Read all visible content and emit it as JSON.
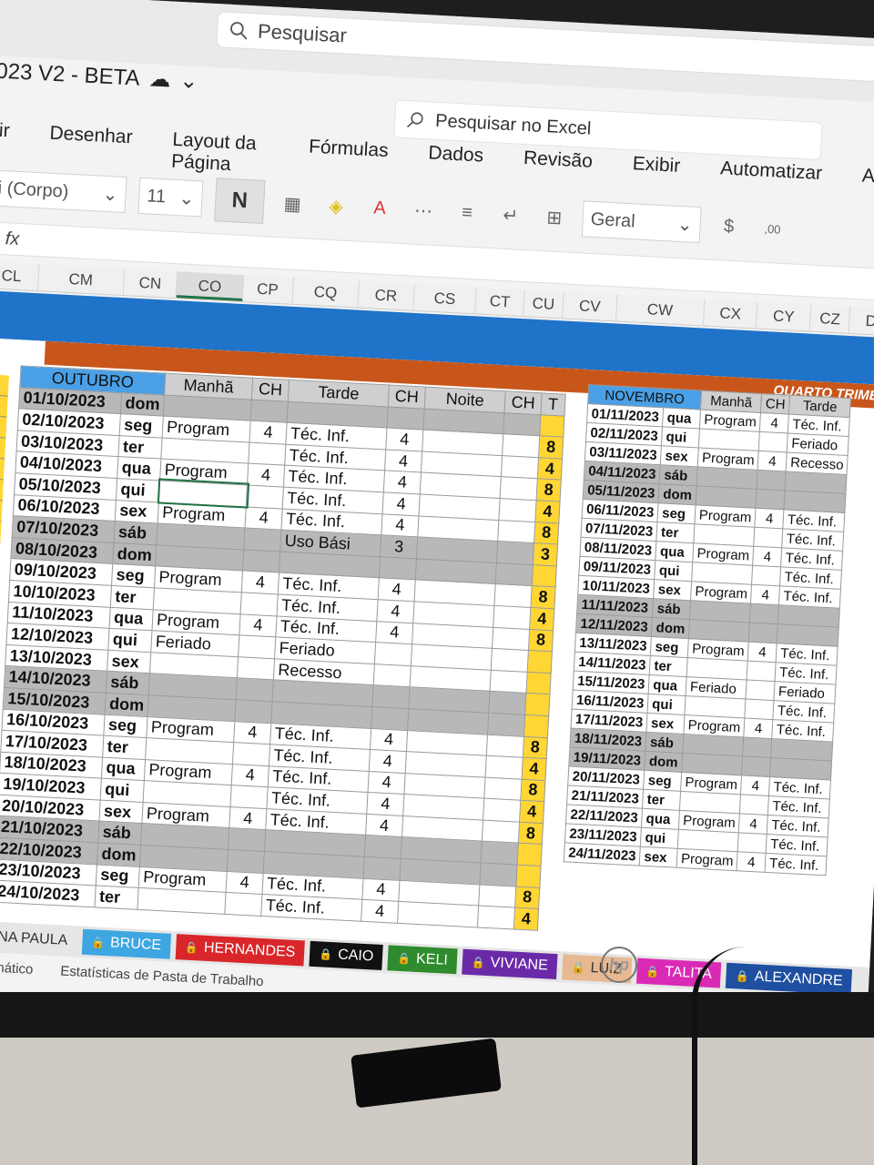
{
  "window": {
    "search_placeholder": "Pesquisar",
    "title": "023 V2 - BETA",
    "excel_search": "Pesquisar no Excel"
  },
  "menu": [
    "rir",
    "Desenhar",
    "Layout da Página",
    "Fórmulas",
    "Dados",
    "Revisão",
    "Exibir",
    "Automatizar",
    "Ajuda"
  ],
  "ribbon": {
    "font": "i (Corpo)",
    "size": "11",
    "bold": "N",
    "number_format": "Geral",
    "currency": "$",
    "decimal": ",00"
  },
  "formula_label": "fx",
  "columns": [
    "CL",
    "CM",
    "CN",
    "CO",
    "CP",
    "CQ",
    "CR",
    "CS",
    "CT",
    "CU",
    "CV",
    "CW",
    "CX",
    "CY",
    "CZ",
    "DA"
  ],
  "active_column": "CO",
  "band_title": "QUARTO TRIMESTI",
  "october": {
    "header": [
      "OUTUBRO",
      "Manhã",
      "CH",
      "Tarde",
      "CH",
      "Noite",
      "CH",
      "T"
    ],
    "rows": [
      {
        "date": "01/10/2023",
        "day": "dom",
        "m": "",
        "mch": "",
        "t": "",
        "tch": "",
        "tot": "",
        "w": true
      },
      {
        "date": "02/10/2023",
        "day": "seg",
        "m": "Program",
        "mch": "4",
        "t": "Téc. Inf.",
        "tch": "4",
        "tot": "8",
        "w": false
      },
      {
        "date": "03/10/2023",
        "day": "ter",
        "m": "",
        "mch": "",
        "t": "Téc. Inf.",
        "tch": "4",
        "tot": "4",
        "w": false
      },
      {
        "date": "04/10/2023",
        "day": "qua",
        "m": "Program",
        "mch": "4",
        "t": "Téc. Inf.",
        "tch": "4",
        "tot": "8",
        "w": false
      },
      {
        "date": "05/10/2023",
        "day": "qui",
        "m": "",
        "mch": "",
        "t": "Téc. Inf.",
        "tch": "4",
        "tot": "4",
        "w": false
      },
      {
        "date": "06/10/2023",
        "day": "sex",
        "m": "Program",
        "mch": "4",
        "t": "Téc. Inf.",
        "tch": "4",
        "tot": "8",
        "w": false
      },
      {
        "date": "07/10/2023",
        "day": "sáb",
        "m": "",
        "mch": "",
        "t": "Uso Bási",
        "tch": "3",
        "tot": "3",
        "w": true
      },
      {
        "date": "08/10/2023",
        "day": "dom",
        "m": "",
        "mch": "",
        "t": "",
        "tch": "",
        "tot": "",
        "w": true
      },
      {
        "date": "09/10/2023",
        "day": "seg",
        "m": "Program",
        "mch": "4",
        "t": "Téc. Inf.",
        "tch": "4",
        "tot": "8",
        "w": false
      },
      {
        "date": "10/10/2023",
        "day": "ter",
        "m": "",
        "mch": "",
        "t": "Téc. Inf.",
        "tch": "4",
        "tot": "4",
        "w": false
      },
      {
        "date": "11/10/2023",
        "day": "qua",
        "m": "Program",
        "mch": "4",
        "t": "Téc. Inf.",
        "tch": "4",
        "tot": "8",
        "w": false
      },
      {
        "date": "12/10/2023",
        "day": "qui",
        "m": "Feriado",
        "mch": "",
        "t": "Feriado",
        "tch": "",
        "tot": "",
        "w": false
      },
      {
        "date": "13/10/2023",
        "day": "sex",
        "m": "",
        "mch": "",
        "t": "Recesso",
        "tch": "",
        "tot": "",
        "w": false
      },
      {
        "date": "14/10/2023",
        "day": "sáb",
        "m": "",
        "mch": "",
        "t": "",
        "tch": "",
        "tot": "",
        "w": true
      },
      {
        "date": "15/10/2023",
        "day": "dom",
        "m": "",
        "mch": "",
        "t": "",
        "tch": "",
        "tot": "",
        "w": true
      },
      {
        "date": "16/10/2023",
        "day": "seg",
        "m": "Program",
        "mch": "4",
        "t": "Téc. Inf.",
        "tch": "4",
        "tot": "8",
        "w": false
      },
      {
        "date": "17/10/2023",
        "day": "ter",
        "m": "",
        "mch": "",
        "t": "Téc. Inf.",
        "tch": "4",
        "tot": "4",
        "w": false
      },
      {
        "date": "18/10/2023",
        "day": "qua",
        "m": "Program",
        "mch": "4",
        "t": "Téc. Inf.",
        "tch": "4",
        "tot": "8",
        "w": false
      },
      {
        "date": "19/10/2023",
        "day": "qui",
        "m": "",
        "mch": "",
        "t": "Téc. Inf.",
        "tch": "4",
        "tot": "4",
        "w": false
      },
      {
        "date": "20/10/2023",
        "day": "sex",
        "m": "Program",
        "mch": "4",
        "t": "Téc. Inf.",
        "tch": "4",
        "tot": "8",
        "w": false
      },
      {
        "date": "21/10/2023",
        "day": "sáb",
        "m": "",
        "mch": "",
        "t": "",
        "tch": "",
        "tot": "",
        "w": true
      },
      {
        "date": "22/10/2023",
        "day": "dom",
        "m": "",
        "mch": "",
        "t": "",
        "tch": "",
        "tot": "",
        "w": true
      },
      {
        "date": "23/10/2023",
        "day": "seg",
        "m": "Program",
        "mch": "4",
        "t": "Téc. Inf.",
        "tch": "4",
        "tot": "8",
        "w": false
      },
      {
        "date": "24/10/2023",
        "day": "ter",
        "m": "",
        "mch": "",
        "t": "Téc. Inf.",
        "tch": "4",
        "tot": "4",
        "w": false
      }
    ]
  },
  "november": {
    "header": [
      "NOVEMBRO",
      "Manhã",
      "CH",
      "Tarde"
    ],
    "rows": [
      {
        "date": "01/11/2023",
        "day": "qua",
        "m": "Program",
        "mch": "4",
        "t": "Téc. Inf.",
        "w": false
      },
      {
        "date": "02/11/2023",
        "day": "qui",
        "m": "",
        "mch": "",
        "t": "Feriado",
        "w": false
      },
      {
        "date": "03/11/2023",
        "day": "sex",
        "m": "Program",
        "mch": "4",
        "t": "Recesso",
        "w": false
      },
      {
        "date": "04/11/2023",
        "day": "sáb",
        "m": "",
        "mch": "",
        "t": "",
        "w": true
      },
      {
        "date": "05/11/2023",
        "day": "dom",
        "m": "",
        "mch": "",
        "t": "",
        "w": true
      },
      {
        "date": "06/11/2023",
        "day": "seg",
        "m": "Program",
        "mch": "4",
        "t": "Téc. Inf.",
        "w": false
      },
      {
        "date": "07/11/2023",
        "day": "ter",
        "m": "",
        "mch": "",
        "t": "Téc. Inf.",
        "w": false
      },
      {
        "date": "08/11/2023",
        "day": "qua",
        "m": "Program",
        "mch": "4",
        "t": "Téc. Inf.",
        "w": false
      },
      {
        "date": "09/11/2023",
        "day": "qui",
        "m": "",
        "mch": "",
        "t": "Téc. Inf.",
        "w": false
      },
      {
        "date": "10/11/2023",
        "day": "sex",
        "m": "Program",
        "mch": "4",
        "t": "Téc. Inf.",
        "w": false
      },
      {
        "date": "11/11/2023",
        "day": "sáb",
        "m": "",
        "mch": "",
        "t": "",
        "w": true
      },
      {
        "date": "12/11/2023",
        "day": "dom",
        "m": "",
        "mch": "",
        "t": "",
        "w": true
      },
      {
        "date": "13/11/2023",
        "day": "seg",
        "m": "Program",
        "mch": "4",
        "t": "Téc. Inf.",
        "w": false
      },
      {
        "date": "14/11/2023",
        "day": "ter",
        "m": "",
        "mch": "",
        "t": "Téc. Inf.",
        "w": false
      },
      {
        "date": "15/11/2023",
        "day": "qua",
        "m": "Feriado",
        "mch": "",
        "t": "Feriado",
        "w": false
      },
      {
        "date": "16/11/2023",
        "day": "qui",
        "m": "",
        "mch": "",
        "t": "Téc. Inf.",
        "w": false
      },
      {
        "date": "17/11/2023",
        "day": "sex",
        "m": "Program",
        "mch": "4",
        "t": "Téc. Inf.",
        "w": false
      },
      {
        "date": "18/11/2023",
        "day": "sáb",
        "m": "",
        "mch": "",
        "t": "",
        "w": true
      },
      {
        "date": "19/11/2023",
        "day": "dom",
        "m": "",
        "mch": "",
        "t": "",
        "w": true
      },
      {
        "date": "20/11/2023",
        "day": "seg",
        "m": "Program",
        "mch": "4",
        "t": "Téc. Inf.",
        "w": false
      },
      {
        "date": "21/11/2023",
        "day": "ter",
        "m": "",
        "mch": "",
        "t": "Téc. Inf.",
        "w": false
      },
      {
        "date": "22/11/2023",
        "day": "qua",
        "m": "Program",
        "mch": "4",
        "t": "Téc. Inf.",
        "w": false
      },
      {
        "date": "23/11/2023",
        "day": "qui",
        "m": "",
        "mch": "",
        "t": "Téc. Inf.",
        "w": false
      },
      {
        "date": "24/11/2023",
        "day": "sex",
        "m": "Program",
        "mch": "4",
        "t": "Téc. Inf.",
        "w": false
      }
    ]
  },
  "left_totals": [
    "8",
    "4",
    "8",
    "4",
    "8",
    "3",
    "",
    "8",
    "4",
    "8",
    "4",
    "8",
    "3"
  ],
  "sheet_tabs": [
    {
      "label": "ANA PAULA",
      "color": "#e6e6e6",
      "text": "#333"
    },
    {
      "label": "BRUCE",
      "color": "#3ea6e0",
      "text": "#fff"
    },
    {
      "label": "HERNANDES",
      "color": "#d9262a",
      "text": "#fff"
    },
    {
      "label": "CAIO",
      "color": "#111111",
      "text": "#fff"
    },
    {
      "label": "KELI",
      "color": "#2e8b2e",
      "text": "#fff"
    },
    {
      "label": "VIVIANE",
      "color": "#6a2aa8",
      "text": "#fff"
    },
    {
      "label": "LUIZ",
      "color": "#e8b890",
      "text": "#333"
    },
    {
      "label": "TALITA",
      "color": "#d92ab5",
      "text": "#fff"
    },
    {
      "label": "ALEXANDRE",
      "color": "#1f4fa0",
      "text": "#fff"
    }
  ],
  "status": {
    "mode": ": Automático",
    "stats": "Estatísticas de Pasta de Trabalho"
  },
  "brand": "hp"
}
